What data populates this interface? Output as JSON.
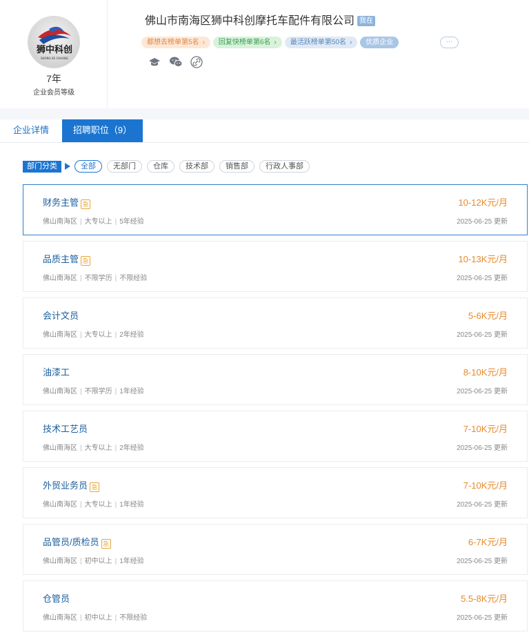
{
  "company": {
    "name": "佛山市南海区狮中科创摩托车配件有限公司",
    "verified_badge": "我在",
    "member_years": "7年",
    "member_level": "企业会员等级",
    "logo_text": "狮中科创",
    "logo_subtext": "SHONG KE CHUANG"
  },
  "tags": [
    {
      "label": "都想去榜单第5名",
      "style": "orange",
      "chevron": "›"
    },
    {
      "label": "回复快榜单第6名",
      "style": "green",
      "chevron": "›"
    },
    {
      "label": "最活跃榜单第50名",
      "style": "blue",
      "chevron": "›"
    },
    {
      "label": "优质企业",
      "style": "solid",
      "chevron": ""
    }
  ],
  "more_label": "···",
  "social_icons": [
    "graduation-cap-icon",
    "wechat-icon",
    "link-icon"
  ],
  "tabs": {
    "detail": "企业详情",
    "jobs": "招聘职位（9）"
  },
  "filters": {
    "label": "部门分类",
    "options": [
      "全部",
      "无部门",
      "仓库",
      "技术部",
      "销售部",
      "行政人事部"
    ],
    "active_index": 0
  },
  "urgent_label": "急",
  "jobs": [
    {
      "title": "财务主管",
      "urgent": true,
      "location": "佛山南海区",
      "education": "大专以上",
      "experience": "5年经验",
      "salary": "10-12K元/月",
      "date": "2025-06-25 更新"
    },
    {
      "title": "品质主管",
      "urgent": true,
      "location": "佛山南海区",
      "education": "不限学历",
      "experience": "不限经验",
      "salary": "10-13K元/月",
      "date": "2025-06-25 更新"
    },
    {
      "title": "会计文员",
      "urgent": false,
      "location": "佛山南海区",
      "education": "大专以上",
      "experience": "2年经验",
      "salary": "5-6K元/月",
      "date": "2025-06-25 更新"
    },
    {
      "title": "油漆工",
      "urgent": false,
      "location": "佛山南海区",
      "education": "不限学历",
      "experience": "1年经验",
      "salary": "8-10K元/月",
      "date": "2025-06-25 更新"
    },
    {
      "title": "技术工艺员",
      "urgent": false,
      "location": "佛山南海区",
      "education": "大专以上",
      "experience": "2年经验",
      "salary": "7-10K元/月",
      "date": "2025-06-25 更新"
    },
    {
      "title": "外贸业务员",
      "urgent": true,
      "location": "佛山南海区",
      "education": "大专以上",
      "experience": "1年经验",
      "salary": "7-10K元/月",
      "date": "2025-06-25 更新"
    },
    {
      "title": "品管员/质检员",
      "urgent": true,
      "location": "佛山南海区",
      "education": "初中以上",
      "experience": "1年经验",
      "salary": "6-7K元/月",
      "date": "2025-06-25 更新"
    },
    {
      "title": "仓管员",
      "urgent": false,
      "location": "佛山南海区",
      "education": "初中以上",
      "experience": "不限经验",
      "salary": "5.5-8K元/月",
      "date": "2025-06-25 更新"
    }
  ],
  "colors": {
    "primary": "#1b75d0",
    "salary": "#e58a2c",
    "title": "#1a5f9e",
    "urgent": "#e8a536"
  }
}
